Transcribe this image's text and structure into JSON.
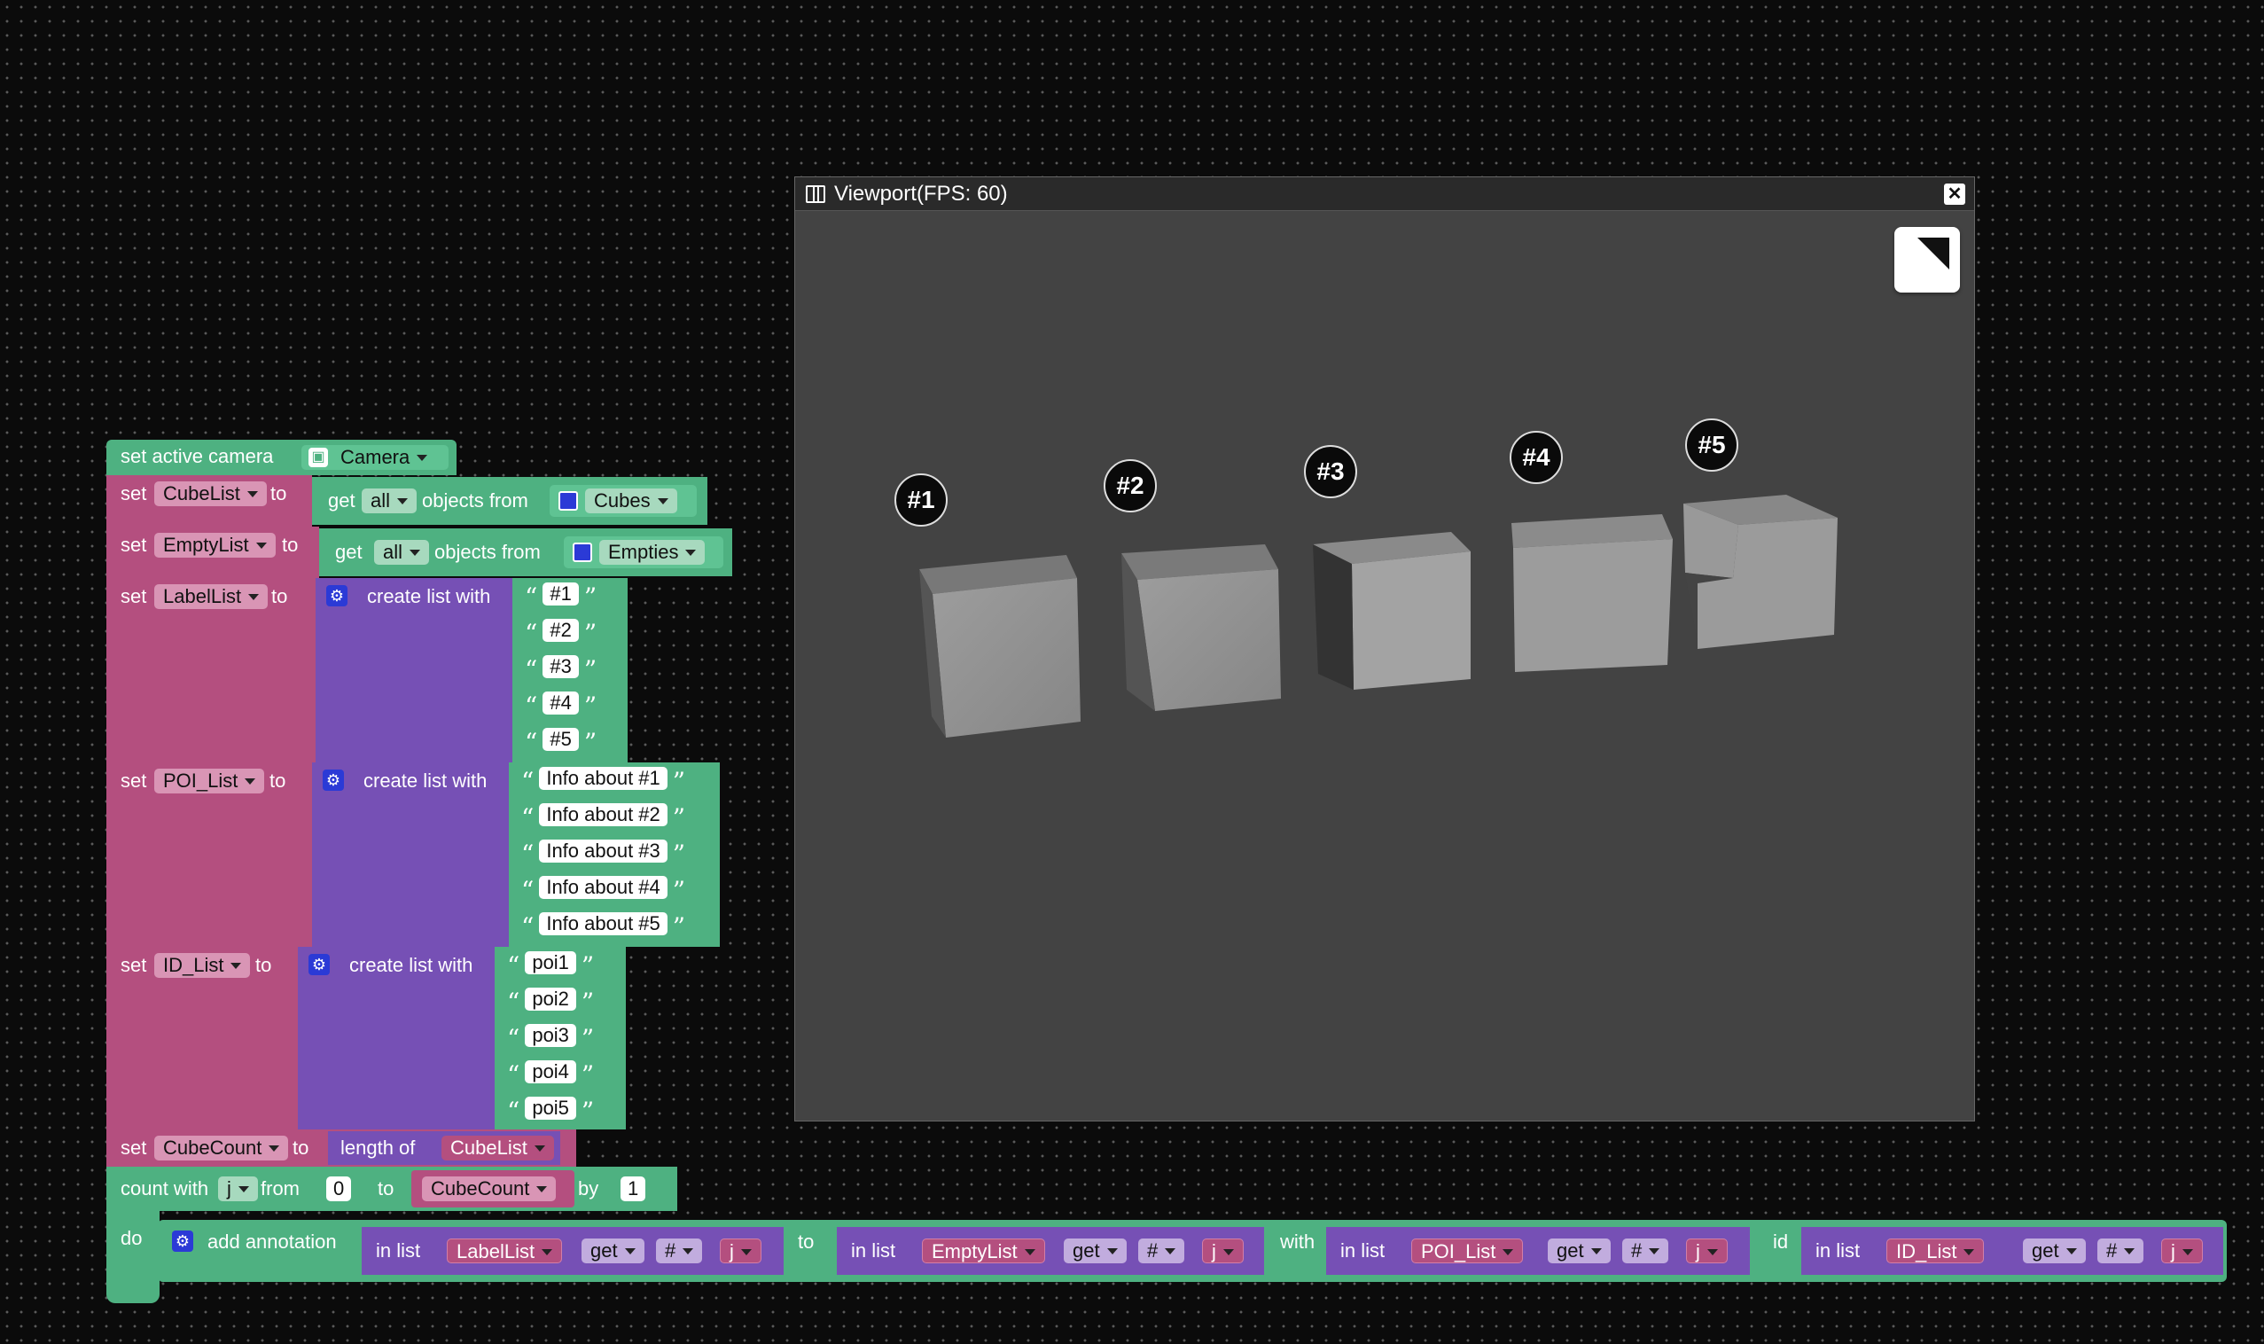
{
  "viewport": {
    "title": "Viewport(FPS: 60)",
    "close_icon": "close-icon",
    "panel_icon": "panel-icon",
    "fullscreen_icon": "fullscreen-icon",
    "markers": [
      "#1",
      "#2",
      "#3",
      "#4",
      "#5"
    ]
  },
  "blocks": {
    "camera": {
      "label": "set active camera",
      "value": "Camera"
    },
    "cubelist": {
      "set": "set",
      "var": "CubeList",
      "to": "to",
      "get": "get",
      "mode": "all",
      "objects_from": "objects from",
      "source": "Cubes"
    },
    "emptylist": {
      "set": "set",
      "var": "EmptyList",
      "to": "to",
      "get": "get",
      "mode": "all",
      "objects_from": "objects from",
      "source": "Empties"
    },
    "labellist": {
      "set": "set",
      "var": "LabelList",
      "to": "to",
      "create": "create list with",
      "items": [
        "#1",
        "#2",
        "#3",
        "#4",
        "#5"
      ]
    },
    "poilist": {
      "set": "set",
      "var": "POI_List",
      "to": "to",
      "create": "create list with",
      "items": [
        "Info about #1",
        "Info about #2",
        "Info about #3",
        "Info about #4",
        "Info about #5"
      ]
    },
    "idlist": {
      "set": "set",
      "var": "ID_List",
      "to": "to",
      "create": "create list with",
      "items": [
        "poi1",
        "poi2",
        "poi3",
        "poi4",
        "poi5"
      ]
    },
    "cubecount": {
      "set": "set",
      "var": "CubeCount",
      "to": "to",
      "length_of": "length of",
      "source": "CubeList"
    },
    "loop": {
      "count_with": "count with",
      "var": "j",
      "from": "from",
      "from_val": "0",
      "to": "to",
      "to_var": "CubeCount",
      "by": "by",
      "by_val": "1",
      "do": "do"
    },
    "annotation": {
      "label": "add annotation",
      "to": "to",
      "with": "with",
      "id": "id",
      "in_list": "in list",
      "get": "get",
      "hash": "#",
      "idx": "j",
      "lists": [
        "LabelList",
        "EmptyList",
        "POI_List",
        "ID_List"
      ]
    }
  },
  "colors": {
    "set_block": "#b44f7f",
    "value_block": "#4eb181",
    "list_block": "#7650b5",
    "viewport_bg": "#434343"
  }
}
